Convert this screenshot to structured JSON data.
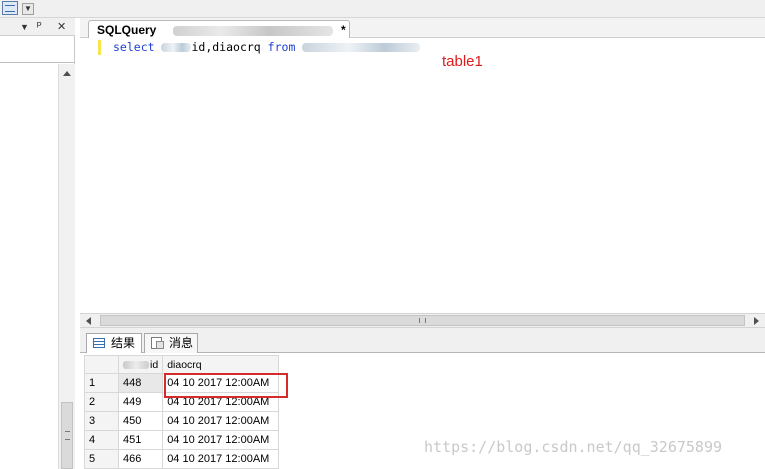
{
  "document_tab": {
    "title_prefix": "SQLQuery",
    "title_suffix": "*"
  },
  "editor": {
    "sql": {
      "kw_select": "select",
      "middle": "id,diaocrq",
      "kw_from": "from"
    },
    "annotation": "table1"
  },
  "results_tabs": {
    "results_label": "结果",
    "messages_label": "消息"
  },
  "grid": {
    "columns": [
      "id",
      "diaocrq"
    ],
    "rows": [
      {
        "num": "1",
        "id": "448",
        "date": "04 10 2017 12:00AM"
      },
      {
        "num": "2",
        "id": "449",
        "date": "04 10 2017 12:00AM"
      },
      {
        "num": "3",
        "id": "450",
        "date": "04 10 2017 12:00AM"
      },
      {
        "num": "4",
        "id": "451",
        "date": "04 10 2017 12:00AM"
      },
      {
        "num": "5",
        "id": "466",
        "date": "04 10 2017 12:00AM"
      }
    ]
  },
  "watermark": "https://blog.csdn.net/qq_32675899",
  "colors": {
    "keyword": "#1f3fd1",
    "annotation": "#e01b1b",
    "highlight": "#d42c2c"
  }
}
